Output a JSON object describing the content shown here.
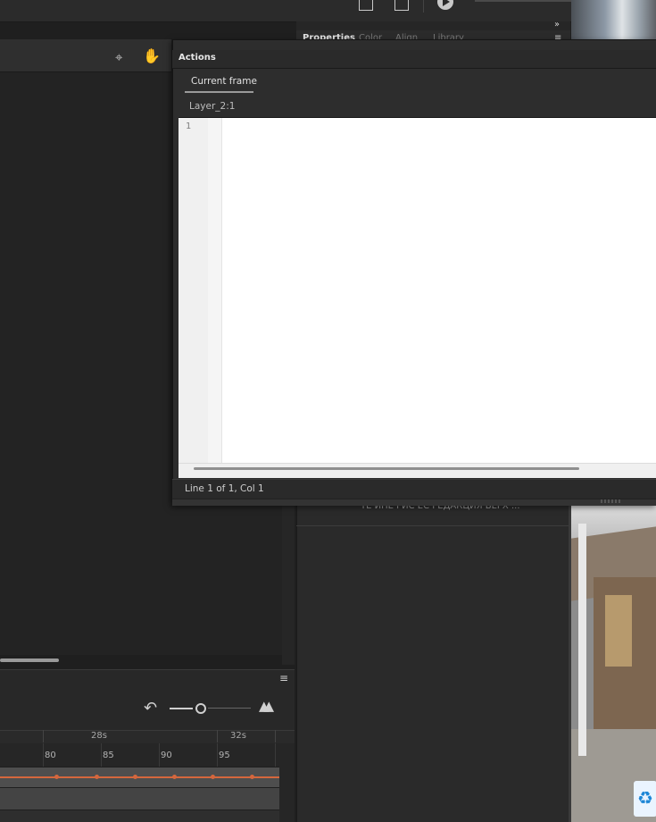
{
  "panel_tabs": [
    "Properties",
    "Color",
    "Align",
    "Library"
  ],
  "right_panel": {
    "cut_text": "ТЕ ИНЕ РИС ЕС РЕДАКЦИЯ ВЕРХ ..."
  },
  "actions_panel": {
    "title": "Actions",
    "tab_current_frame": "Current frame",
    "layer_frame": "Layer_2:1",
    "editor": {
      "line_numbers": [
        "1"
      ],
      "code": ""
    },
    "status": "Line 1 of 1, Col 1"
  },
  "timeline": {
    "seconds_labels": [
      "28s",
      "32s"
    ],
    "frame_labels": [
      "80",
      "85",
      "90",
      "95"
    ]
  },
  "icons": {
    "snap": "snap-icon",
    "hand": "hand-icon",
    "undo": "undo-icon",
    "mountain": "mountain-icon",
    "play": "play-icon",
    "recycle_bin": "recycle-bin-icon"
  },
  "colors": {
    "accent_red": "#d5673d",
    "panel_bg": "#2d2d2d",
    "editor_bg": "#ffffff"
  }
}
